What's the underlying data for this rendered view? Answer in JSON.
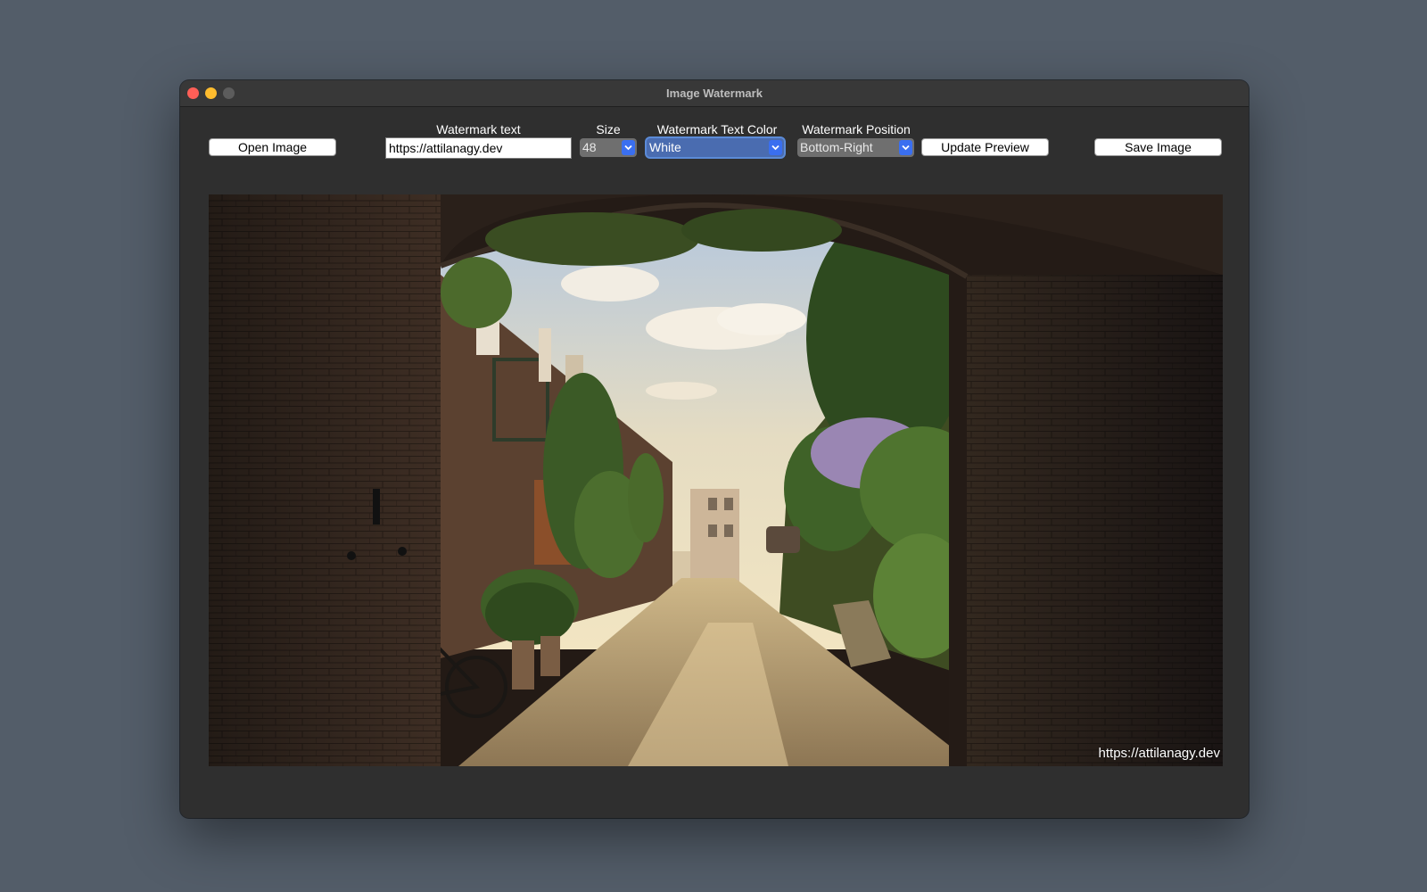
{
  "window": {
    "title": "Image Watermark"
  },
  "toolbar": {
    "open_label": "Open Image",
    "watermark_text_label": "Watermark text",
    "watermark_text_value": "https://attilanagy.dev",
    "size_label": "Size",
    "size_value": "48",
    "color_label": "Watermark Text Color",
    "color_value": "White",
    "position_label": "Watermark Position",
    "position_value": "Bottom-Right",
    "update_label": "Update Preview",
    "save_label": "Save Image"
  },
  "preview": {
    "watermark": "https://attilanagy.dev"
  },
  "colors": {
    "accent": "#3a6ff0",
    "window_bg": "#2f2f2f",
    "desktop_bg": "#535d69"
  }
}
